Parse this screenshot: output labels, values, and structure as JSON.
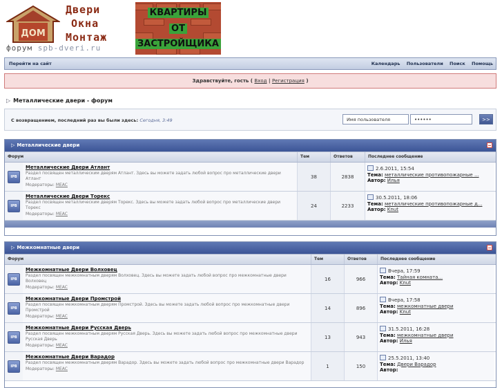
{
  "header": {
    "logo_lines": [
      "Двери",
      "Окна",
      "Монтаж"
    ],
    "logo_house_text": "ДОМ",
    "forum_prefix": "форум",
    "forum_site": "spb-dveri.ru",
    "banner_lines": [
      "КВАРТИРЫ",
      "ОТ",
      "ЗАСТРОЙЩИКА"
    ]
  },
  "topnav": {
    "left": "Перейти на сайт",
    "right": [
      "Календарь",
      "Пользователи",
      "Поиск",
      "Помощь"
    ]
  },
  "welcome": {
    "prefix": "Здравствуйте, гость (",
    "login": "Вход",
    "sep": "|",
    "register": "Регистрация",
    "suffix": ")"
  },
  "breadcrumb": "Металлические двери - форум",
  "loginbar": {
    "text": "С возвращением, последний раз вы были здесь:",
    "time": "Сегодня, 3:49",
    "username_value": "Имя пользователя",
    "password_value": "••••••",
    "go_label": ">>"
  },
  "columns": {
    "forum": "Форум",
    "topics": "Тем",
    "replies": "Ответов",
    "last": "Последнее сообщение"
  },
  "labels": {
    "moderators": "Модераторы:",
    "topic": "Тема:",
    "author": "Автор:",
    "ipb": "IPB"
  },
  "categories": [
    {
      "title": "Металлические двери",
      "forums": [
        {
          "name": "Металлические Двери Атлант",
          "desc": "Раздел посвящен металлическим дверям Атлант. Здесь вы можете задать любой вопрос про металлические двери Атлант",
          "moderator": "MEAC",
          "topics": "38",
          "replies": "2838",
          "last_date": "2.6.2011, 15:54",
          "last_topic": "металлические противопожарные ...",
          "last_author": "Илья"
        },
        {
          "name": "Металлические Двери Торекс",
          "desc": "Раздел посвящен металлическим дверям Торекс. Здесь вы можете задать любой вопрос про металлические двери Торекс",
          "moderator": "MEAC",
          "topics": "24",
          "replies": "2233",
          "last_date": "30.5.2011, 18:06",
          "last_topic": "металлические противопожарные д...",
          "last_author": "Knut"
        }
      ]
    },
    {
      "title": "Межкомнатные двери",
      "forums": [
        {
          "name": "Межкомнатные Двери Волховец",
          "desc": "Раздел посвящен межкомнатным дверям Волховец. Здесь вы можете задать любой вопрос про межкомнатные двери Волховец",
          "moderator": "MEAC",
          "topics": "16",
          "replies": "966",
          "last_date": "Вчера, 17:59",
          "last_topic": "Тайная комната...",
          "last_author": "Knut"
        },
        {
          "name": "Межкомнатные Двери Промстрой",
          "desc": "Раздел посвящен межкомнатным дверям Промстрой. Здесь вы можете задать любой вопрос про межкомнатные двери Промстрой",
          "moderator": "MEAC",
          "topics": "14",
          "replies": "896",
          "last_date": "Вчера, 17:58",
          "last_topic": "межкомнатные двери",
          "last_author": "Knut"
        },
        {
          "name": "Межкомнатные Двери Русская Дверь",
          "desc": "Раздел посвящен межкомнатным дверям Русская Дверь. Здесь вы можете задать любой вопрос про межкомнатные двери Русская Дверь",
          "moderator": "MEAC",
          "topics": "13",
          "replies": "943",
          "last_date": "31.5.2011, 16:28",
          "last_topic": "межкомнатные двери",
          "last_author": "Илья"
        },
        {
          "name": "Межкомнатные Двери Варадор",
          "desc": "Раздел посвящен межкомнатным дверям Варадор. Здесь вы можете задать любой вопрос про межкомнатные двери Варадор",
          "moderator": "MEAC",
          "topics": "1",
          "replies": "150",
          "last_date": "25.5.2011, 13:40",
          "last_topic": "Двери Варадор",
          "last_author": ""
        }
      ]
    }
  ]
}
